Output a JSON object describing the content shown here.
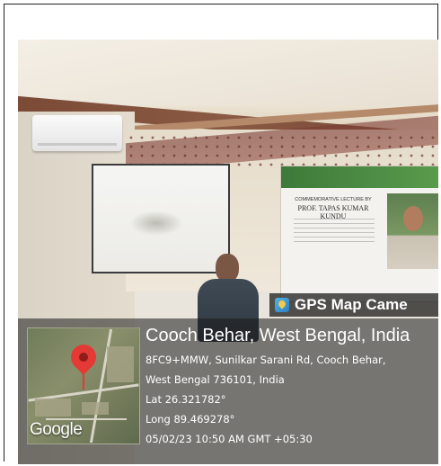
{
  "badge": {
    "label": "GPS Map Came",
    "icon": "gps-map-camera-icon"
  },
  "location": {
    "title": "Cooch Behar, West Bengal, India",
    "address_line1": "8FC9+MMW, Sunilkar Sarani Rd, Cooch Behar,",
    "address_line2": "West Bengal 736101, India",
    "lat": "Lat 26.321782°",
    "long": "Long 89.469278°",
    "datetime": "05/02/23 10:50 AM GMT +05:30"
  },
  "map": {
    "provider": "Google",
    "pin_icon": "map-pin-icon",
    "pin_color": "#e53935"
  },
  "banner": {
    "heading": "COMMEMORATIVE LECTURE BY",
    "name": "PROF. TAPAS KUMAR KUNDU"
  }
}
